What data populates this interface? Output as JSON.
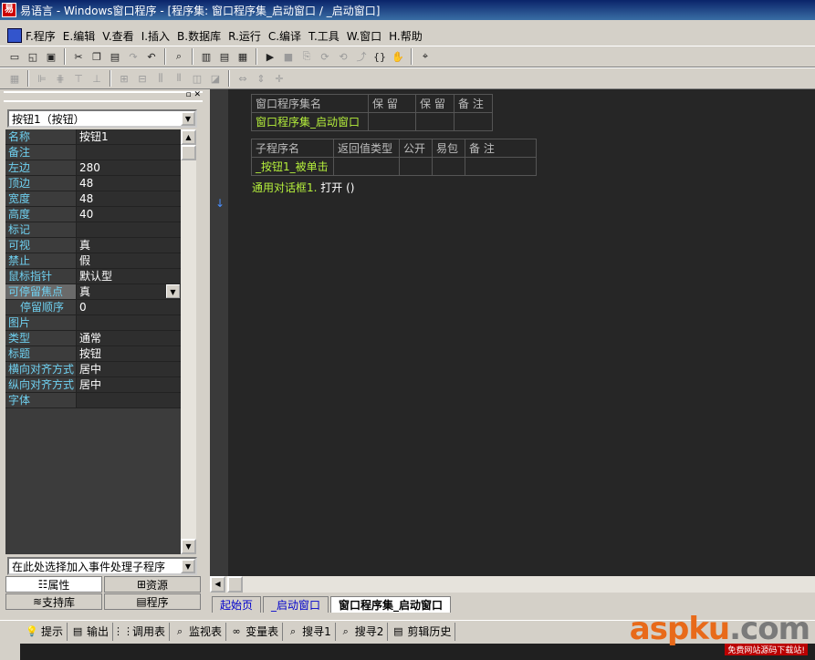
{
  "window": {
    "title": "易语言 - Windows窗口程序 - [程序集: 窗口程序集_启动窗口 / _启动窗口]",
    "app_icon": "易"
  },
  "menu": {
    "items": [
      "F.程序",
      "E.编辑",
      "V.查看",
      "I.插入",
      "B.数据库",
      "R.运行",
      "C.编译",
      "T.工具",
      "W.窗口",
      "H.帮助"
    ]
  },
  "left_panel": {
    "component_combo": "按钮1（按钮）",
    "properties": [
      {
        "name": "名称",
        "value": "按钮1"
      },
      {
        "name": "备注",
        "value": ""
      },
      {
        "name": "左边",
        "value": "280"
      },
      {
        "name": "顶边",
        "value": "48"
      },
      {
        "name": "宽度",
        "value": "48"
      },
      {
        "name": "高度",
        "value": "40"
      },
      {
        "name": "标记",
        "value": ""
      },
      {
        "name": "可视",
        "value": "真"
      },
      {
        "name": "禁止",
        "value": "假"
      },
      {
        "name": "鼠标指针",
        "value": "默认型"
      },
      {
        "name": "可停留焦点",
        "value": "真"
      },
      {
        "name": "停留顺序",
        "value": "0"
      },
      {
        "name": "图片",
        "value": ""
      },
      {
        "name": "类型",
        "value": "通常"
      },
      {
        "name": "标题",
        "value": "按钮"
      },
      {
        "name": "横向对齐方式",
        "value": "居中"
      },
      {
        "name": "纵向对齐方式",
        "value": "居中"
      },
      {
        "name": "字体",
        "value": ""
      }
    ],
    "event_combo": "在此处选择加入事件处理子程序",
    "tabs": {
      "properties": "属性",
      "resources": "资源",
      "support_lib": "支持库",
      "program": "程序"
    }
  },
  "editor": {
    "assembly_table": {
      "headers": [
        "窗口程序集名",
        "保 留",
        "保 留",
        "备 注"
      ],
      "row": [
        "窗口程序集_启动窗口",
        "",
        "",
        ""
      ]
    },
    "sub_table": {
      "headers": [
        "子程序名",
        "返回值类型",
        "公开",
        "易包",
        "备 注"
      ],
      "row": [
        "_按钮1_被单击",
        "",
        "",
        "",
        ""
      ]
    },
    "code_line": {
      "object": "通用对话框1.",
      "method": "打开",
      "args": "()"
    }
  },
  "editor_tabs": [
    "起始页",
    "_启动窗口",
    "窗口程序集_启动窗口"
  ],
  "bottom_tabs": [
    "提示",
    "输出",
    "调用表",
    "监视表",
    "变量表",
    "搜寻1",
    "搜寻2",
    "剪辑历史"
  ],
  "watermark": {
    "main": "aspku",
    "dom": ".com",
    "sub": "免费网站源码下载站!"
  }
}
